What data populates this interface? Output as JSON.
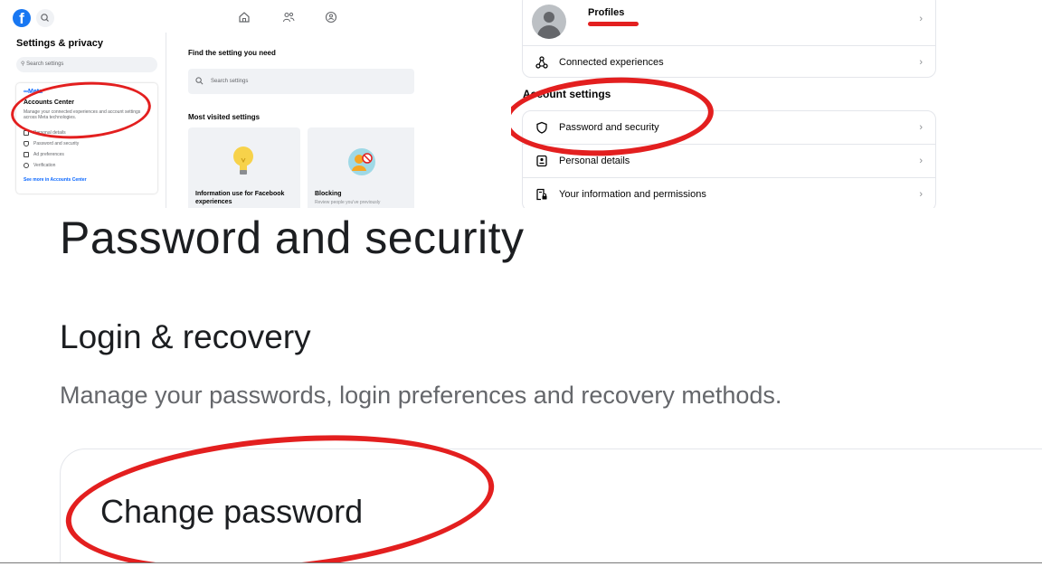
{
  "colors": {
    "brand": "#1877f2",
    "meta_blue": "#0866ff",
    "highlight": "#e31f1f",
    "text_primary": "#1c1e21",
    "text_secondary": "#65676b",
    "surface": "#f0f2f5"
  },
  "left_panel": {
    "logo": "f",
    "sidebar": {
      "title": "Settings & privacy",
      "search_placeholder": "Search settings",
      "accounts_card": {
        "brand": "Meta",
        "title": "Accounts Center",
        "description": "Manage your connected experiences and account settings across Meta technologies.",
        "items": [
          {
            "label": "Personal details",
            "icon": "id-card-icon"
          },
          {
            "label": "Password and security",
            "icon": "shield-icon"
          },
          {
            "label": "Ad preferences",
            "icon": "monitor-icon"
          },
          {
            "label": "Verification",
            "icon": "check-circle-icon"
          }
        ],
        "link": "See more in Accounts Center"
      }
    },
    "main": {
      "find_title": "Find the setting you need",
      "search_placeholder": "Search settings",
      "most_visited_title": "Most visited settings",
      "cards": [
        {
          "label": "Information use for Facebook experiences",
          "icon": "lightbulb-icon"
        },
        {
          "label": "Blocking",
          "sub": "Review people you've previously",
          "icon": "blocked-person-icon"
        }
      ]
    }
  },
  "right_panel": {
    "profiles_label": "Profiles",
    "connected_label": "Connected experiences",
    "account_settings_heading": "Account settings",
    "rows": [
      {
        "label": "Password and security",
        "icon": "shield-icon"
      },
      {
        "label": "Personal details",
        "icon": "id-card-icon"
      },
      {
        "label": "Your information and permissions",
        "icon": "info-lock-icon"
      }
    ],
    "chevron": "›"
  },
  "zoom": {
    "title": "Password and security",
    "subtitle": "Login & recovery",
    "description": "Manage your passwords, login preferences and recovery methods.",
    "card_label": "Change password"
  }
}
